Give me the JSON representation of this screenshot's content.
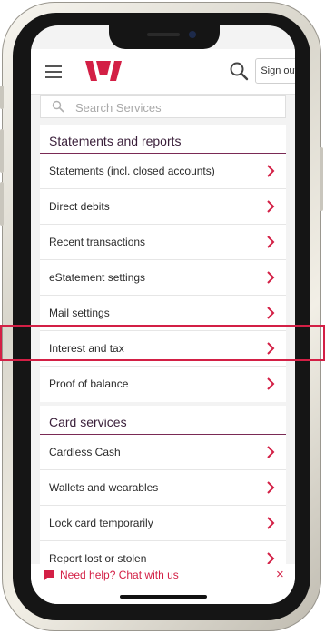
{
  "header": {
    "menu_icon": "hamburger-icon",
    "logo_icon": "westpac-logo-icon",
    "search_icon": "search-icon",
    "sign_out_label": "Sign out"
  },
  "search": {
    "placeholder": "Search Services"
  },
  "statements_section": {
    "title": "Statements and reports",
    "items": [
      {
        "label": "Statements (incl. closed accounts)"
      },
      {
        "label": "Direct debits"
      },
      {
        "label": "Recent transactions"
      },
      {
        "label": "eStatement settings"
      },
      {
        "label": "Mail settings"
      },
      {
        "label": "Interest and tax"
      },
      {
        "label": "Proof of balance"
      }
    ]
  },
  "card_section": {
    "title": "Card services",
    "items": [
      {
        "label": "Cardless Cash"
      },
      {
        "label": "Wallets and wearables"
      },
      {
        "label": "Lock card temporarily"
      },
      {
        "label": "Report lost or stolen"
      }
    ]
  },
  "chat": {
    "label": "Need help? Chat with us",
    "close_label": "×"
  },
  "colors": {
    "brand_red": "#d31f45",
    "section_title": "#3a1f3a",
    "section_divider": "#7a2a55"
  }
}
